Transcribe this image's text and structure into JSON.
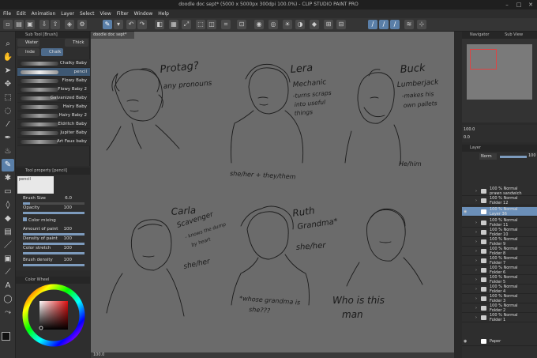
{
  "window": {
    "title": "doodle doc sept* (5000 x 5000px 300dpi 100.0%) - CLIP STUDIO PAINT PRO"
  },
  "menubar": {
    "items": [
      "File",
      "Edit",
      "Animation",
      "Layer",
      "Select",
      "View",
      "Filter",
      "Window",
      "Help"
    ]
  },
  "doc_tab": {
    "label": "doodle doc sept*"
  },
  "subtool": {
    "header": "Sub Tool [Brush]",
    "groups": [
      "Water",
      "Thick",
      "Inde",
      "Chalk"
    ],
    "brushes": [
      "Chalky Baby",
      "pencil",
      "Flowy Baby",
      "Flowy Baby 2",
      "Galvanized Baby",
      "Hairy Baby",
      "Hairy Baby 2",
      "Eldritch Baby",
      "Jupiter Baby",
      "Art Faux baby"
    ]
  },
  "tool_property": {
    "header": "Tool property [pencil]",
    "preview_label": "pencil",
    "brush_size": {
      "label": "Brush Size",
      "value": "6.0",
      "fill": 0.12
    },
    "opacity": {
      "label": "Opacity",
      "value": "100",
      "fill": 1.0
    },
    "color_mixing": {
      "label": "Color mixing"
    },
    "amount_of_paint": {
      "label": "Amount of paint",
      "value": "100",
      "fill": 1.0
    },
    "density_of_paint": {
      "label": "Density of paint",
      "value": "100",
      "fill": 1.0
    },
    "color_stretch": {
      "label": "Color stretch",
      "value": "100",
      "fill": 1.0
    },
    "brush_density": {
      "label": "Brush density",
      "value": "100",
      "fill": 1.0
    }
  },
  "color_panel": {
    "header": "Color Wheel"
  },
  "navigator": {
    "tabs": [
      "Navigator",
      "Sub View"
    ],
    "zoom": "100.0",
    "rotation": "0.0"
  },
  "layer_panel": {
    "header": "Layer",
    "blend_mode": "Norm",
    "opacity": "100",
    "layers": [
      {
        "mode": "100 % Normal",
        "name": "prawn sandwich",
        "type": "folder"
      },
      {
        "mode": "100 % Normal",
        "name": "Folder 12",
        "type": "folder"
      },
      {
        "mode": "100 % Normal",
        "name": "Layer 36",
        "type": "layer",
        "active": true
      },
      {
        "mode": "100 % Normal",
        "name": "Folder 11",
        "type": "folder"
      },
      {
        "mode": "100 % Normal",
        "name": "Folder 10",
        "type": "folder"
      },
      {
        "mode": "100 % Normal",
        "name": "Folder 9",
        "type": "folder"
      },
      {
        "mode": "100 % Normal",
        "name": "Folder 8",
        "type": "folder"
      },
      {
        "mode": "100 % Normal",
        "name": "Folder 7",
        "type": "folder"
      },
      {
        "mode": "100 % Normal",
        "name": "Folder 6",
        "type": "folder"
      },
      {
        "mode": "100 % Normal",
        "name": "Folder 5",
        "type": "folder"
      },
      {
        "mode": "100 % Normal",
        "name": "Folder 4",
        "type": "folder"
      },
      {
        "mode": "100 % Normal",
        "name": "Folder 3",
        "type": "folder"
      },
      {
        "mode": "100 % Normal",
        "name": "Folder 2",
        "type": "folder"
      },
      {
        "mode": "100 % Normal",
        "name": "Folder 1",
        "type": "folder"
      },
      {
        "mode": "",
        "name": "Paper",
        "type": "paper"
      }
    ]
  },
  "status": {
    "zoom": "100.0"
  },
  "sketch_notes": {
    "a1": "Protag?",
    "a2": "any pronouns",
    "b1": "Lera",
    "b2": "Mechanic",
    "b3": "-turns scraps",
    "b4": "into useful",
    "b5": "things",
    "b6": "she/her + they/them",
    "c1": "Buck",
    "c2": "Lumberjack",
    "c3": "-makes his",
    "c4": "own pallets",
    "c5": "He/him",
    "d1": "Carla",
    "d2": "Scavenger",
    "d3": "- knows the dump",
    "d4": "by heart",
    "d5": "she/her",
    "e1": "Ruth",
    "e2": "Grandma*",
    "e3": "she/her",
    "e4": "*whose grandma is",
    "e5": "she???",
    "f1": "Who is this",
    "f2": "man"
  },
  "colors": {
    "accent": "#5a7fa8",
    "canvas": "#6b6b6b",
    "active_layer": "#6b8fb8"
  }
}
